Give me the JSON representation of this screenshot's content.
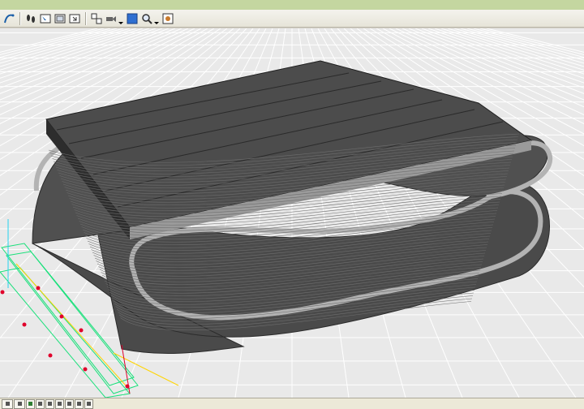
{
  "toolbar": {
    "buttons": [
      {
        "name": "curve-tool-icon",
        "group": 1
      },
      {
        "name": "walk-tool-icon",
        "group": 2
      },
      {
        "name": "select-view-icon",
        "group": 2
      },
      {
        "name": "single-view-icon",
        "group": 2
      },
      {
        "name": "zoom-window-icon",
        "group": 2
      },
      {
        "name": "multi-view-icon",
        "group": 3
      },
      {
        "name": "camera-icon",
        "group": 3
      },
      {
        "name": "shaded-mode-icon",
        "group": 3
      },
      {
        "name": "zoom-magnify-icon",
        "group": 3
      },
      {
        "name": "render-settings-icon",
        "group": 3
      }
    ]
  },
  "viewport": {
    "background": "#e9e9e9",
    "grid_color": "#ffffff",
    "model_fill": "#474747",
    "model_edge": "#bdbdbd",
    "model_rim": "#a9a9a9"
  },
  "bottombar": {
    "buttons": [
      "layout-icon",
      "layer-icon",
      "view-tab-1",
      "view-tab-2",
      "view-tab-3",
      "view-tab-4",
      "view-tab-5",
      "view-tab-6",
      "view-tab-7"
    ]
  }
}
